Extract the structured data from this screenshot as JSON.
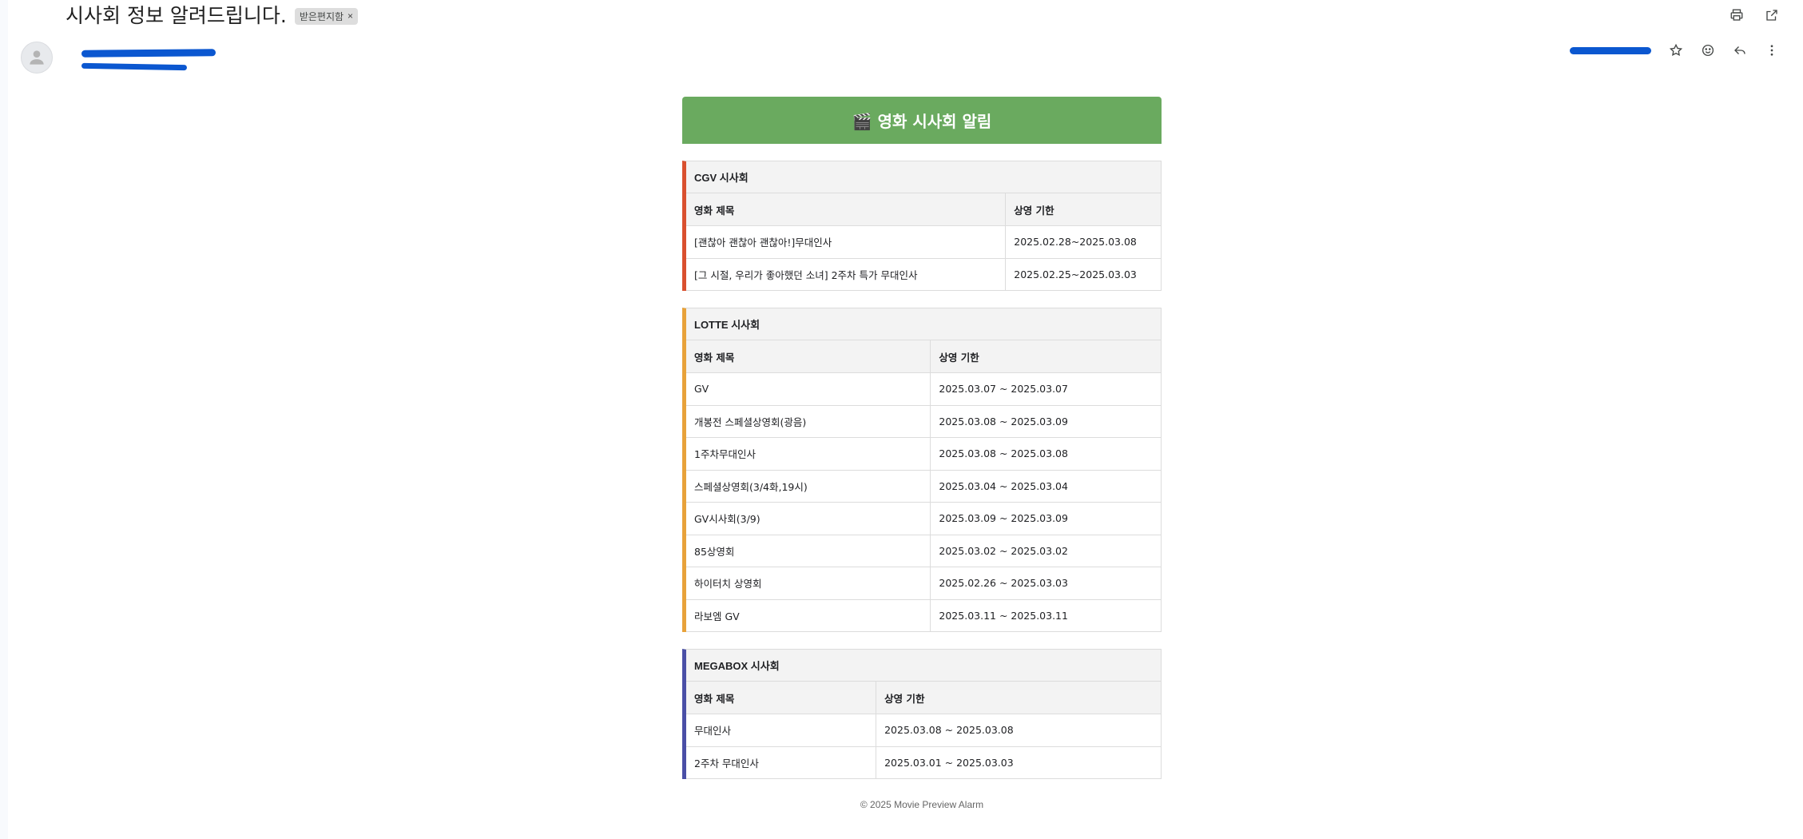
{
  "subject": "시사회 정보 알려드립니다.",
  "label_chip": "받은편지함",
  "label_chip_close": "×",
  "banner_title": "🎬 영화 시사회 알림",
  "col_title": "영화 제목",
  "col_period": "상영 기한",
  "sections": [
    {
      "title": "CGV 시사회",
      "rows": [
        {
          "movie": "[괜찮아 괜찮아 괜찮아!]무대인사",
          "period": "2025.02.28~2025.03.08"
        },
        {
          "movie": "[그 시절, 우리가 좋아했던 소녀] 2주차 특가 무대인사",
          "period": "2025.02.25~2025.03.03"
        }
      ]
    },
    {
      "title": "LOTTE 시사회",
      "rows": [
        {
          "movie": "GV",
          "period": "2025.03.07 ~ 2025.03.07"
        },
        {
          "movie": "개봉전 스페셜상영회(광음)",
          "period": "2025.03.08 ~ 2025.03.09"
        },
        {
          "movie": "1주차무대인사",
          "period": "2025.03.08 ~ 2025.03.08"
        },
        {
          "movie": "스페셜상영회(3/4화,19시)",
          "period": "2025.03.04 ~ 2025.03.04"
        },
        {
          "movie": "GV시사회(3/9)",
          "period": "2025.03.09 ~ 2025.03.09"
        },
        {
          "movie": "85상영회",
          "period": "2025.03.02 ~ 2025.03.02"
        },
        {
          "movie": "하이터치 상영회",
          "period": "2025.02.26 ~ 2025.03.03"
        },
        {
          "movie": "라보엠 GV",
          "period": "2025.03.11 ~ 2025.03.11"
        }
      ]
    },
    {
      "title": "MEGABOX 시사회",
      "rows": [
        {
          "movie": "무대인사",
          "period": "2025.03.08 ~ 2025.03.08"
        },
        {
          "movie": "2주차 무대인사",
          "period": "2025.03.01 ~ 2025.03.03"
        }
      ]
    }
  ],
  "footer": "© 2025 Movie Preview Alarm",
  "colors": {
    "banner": "#6aaa5f",
    "cgv_accent": "#d9502f",
    "lotte_accent": "#e8a23a",
    "megabox_accent": "#4a4fa6",
    "redaction": "#0b57d0"
  },
  "icons": {
    "top": [
      "print-icon",
      "open-in-new-window-icon"
    ],
    "message": [
      "star-icon",
      "emoji-reaction-icon",
      "reply-icon",
      "more-vertical-icon"
    ]
  }
}
